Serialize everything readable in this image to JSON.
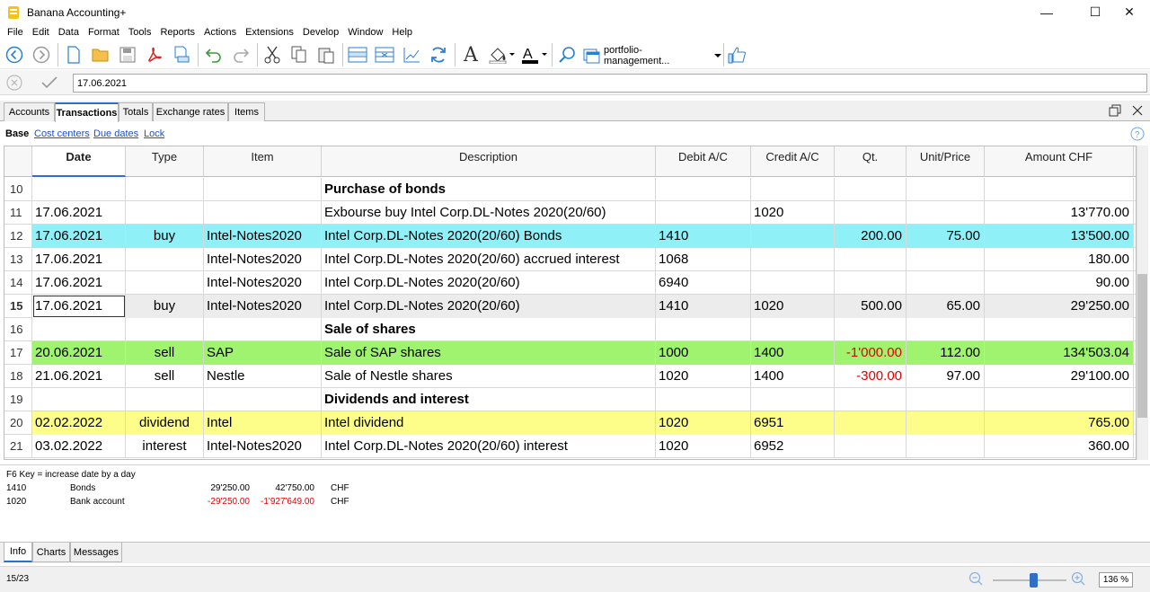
{
  "window": {
    "title": "Banana Accounting+",
    "minimize": "—",
    "maximize": "☐",
    "close": "✕"
  },
  "menu": [
    "File",
    "Edit",
    "Data",
    "Format",
    "Tools",
    "Reports",
    "Actions",
    "Extensions",
    "Develop",
    "Window",
    "Help"
  ],
  "toolbar": {
    "document_dropdown": "portfolio-management..."
  },
  "edit_bar": {
    "value": "17.06.2021"
  },
  "tabs": [
    "Accounts",
    "Transactions",
    "Totals",
    "Exchange rates",
    "Items"
  ],
  "views": {
    "base": "Base",
    "cost_centers": "Cost centers",
    "due_dates": "Due dates",
    "lock": "Lock"
  },
  "columns": [
    "Date",
    "Type",
    "Item",
    "Description",
    "Debit A/C",
    "Credit A/C",
    "Qt.",
    "Unit/Price",
    "Amount CHF"
  ],
  "rows": [
    {
      "n": "10",
      "date": "",
      "type": "",
      "item": "",
      "desc": "Purchase of bonds",
      "debit": "",
      "credit": "",
      "qt": "",
      "price": "",
      "amount": "",
      "style": "heading"
    },
    {
      "n": "11",
      "date": "17.06.2021",
      "type": "",
      "item": "",
      "desc": "Exbourse buy Intel Corp.DL-Notes 2020(20/60)",
      "debit": "",
      "credit": "1020",
      "qt": "",
      "price": "",
      "amount": "13'770.00",
      "style": "normal"
    },
    {
      "n": "12",
      "date": "17.06.2021",
      "type": "buy",
      "item": "Intel-Notes2020",
      "desc": "Intel Corp.DL-Notes 2020(20/60) Bonds",
      "debit": "1410",
      "credit": "",
      "qt": "200.00",
      "price": "75.00",
      "amount": "13'500.00",
      "style": "cyan"
    },
    {
      "n": "13",
      "date": "17.06.2021",
      "type": "",
      "item": "Intel-Notes2020",
      "desc": "Intel Corp.DL-Notes 2020(20/60) accrued interest",
      "debit": "1068",
      "credit": "",
      "qt": "",
      "price": "",
      "amount": "180.00",
      "style": "normal"
    },
    {
      "n": "14",
      "date": "17.06.2021",
      "type": "",
      "item": "Intel-Notes2020",
      "desc": "Intel Corp.DL-Notes 2020(20/60)",
      "debit": "6940",
      "credit": "",
      "qt": "",
      "price": "",
      "amount": "90.00",
      "style": "normal"
    },
    {
      "n": "15",
      "date": "17.06.2021",
      "type": "buy",
      "item": "Intel-Notes2020",
      "desc": "Intel Corp.DL-Notes 2020(20/60)",
      "debit": "1410",
      "credit": "1020",
      "qt": "500.00",
      "price": "65.00",
      "amount": "29'250.00",
      "style": "selected"
    },
    {
      "n": "16",
      "date": "",
      "type": "",
      "item": "",
      "desc": "Sale of shares",
      "debit": "",
      "credit": "",
      "qt": "",
      "price": "",
      "amount": "",
      "style": "heading"
    },
    {
      "n": "17",
      "date": "20.06.2021",
      "type": "sell",
      "item": "SAP",
      "desc": "Sale of SAP shares",
      "debit": "1000",
      "credit": "1400",
      "qt": "-1'000.00",
      "price": "112.00",
      "amount": "134'503.04",
      "style": "green"
    },
    {
      "n": "18",
      "date": "21.06.2021",
      "type": "sell",
      "item": "Nestle",
      "desc": "Sale of Nestle shares",
      "debit": "1020",
      "credit": "1400",
      "qt": "-300.00",
      "price": "97.00",
      "amount": "29'100.00",
      "style": "normal"
    },
    {
      "n": "19",
      "date": "",
      "type": "",
      "item": "",
      "desc": "Dividends and interest",
      "debit": "",
      "credit": "",
      "qt": "",
      "price": "",
      "amount": "",
      "style": "heading"
    },
    {
      "n": "20",
      "date": "02.02.2022",
      "type": "dividend",
      "item": "Intel",
      "desc": "Intel dividend",
      "debit": "1020",
      "credit": "6951",
      "qt": "",
      "price": "",
      "amount": "765.00",
      "style": "yellow"
    },
    {
      "n": "21",
      "date": "03.02.2022",
      "type": "interest",
      "item": "Intel-Notes2020",
      "desc": "Intel Corp.DL-Notes 2020(20/60) interest",
      "debit": "1020",
      "credit": "6952",
      "qt": "",
      "price": "",
      "amount": "360.00",
      "style": "normal"
    }
  ],
  "colors": {
    "cyan": "#8ff0f8",
    "green": "#a0f36e",
    "yellow": "#fdfd8a",
    "selected": "#ececec",
    "negative": "#e00000",
    "accent": "#2f6fc5"
  },
  "info": {
    "hint": "F6 Key = increase date by a day",
    "lines": [
      {
        "account": "1410",
        "name": "Bonds",
        "v1": "29'250.00",
        "v2": "42'750.00",
        "cur": "CHF",
        "neg": false
      },
      {
        "account": "1020",
        "name": "Bank account",
        "v1": "-29'250.00",
        "v2": "-1'927'649.00",
        "cur": "CHF",
        "neg": true
      }
    ]
  },
  "bottom_tabs": [
    "Info",
    "Charts",
    "Messages"
  ],
  "status": {
    "position": "15/23",
    "zoom": "136 %",
    "zoom_level": 0.55
  }
}
